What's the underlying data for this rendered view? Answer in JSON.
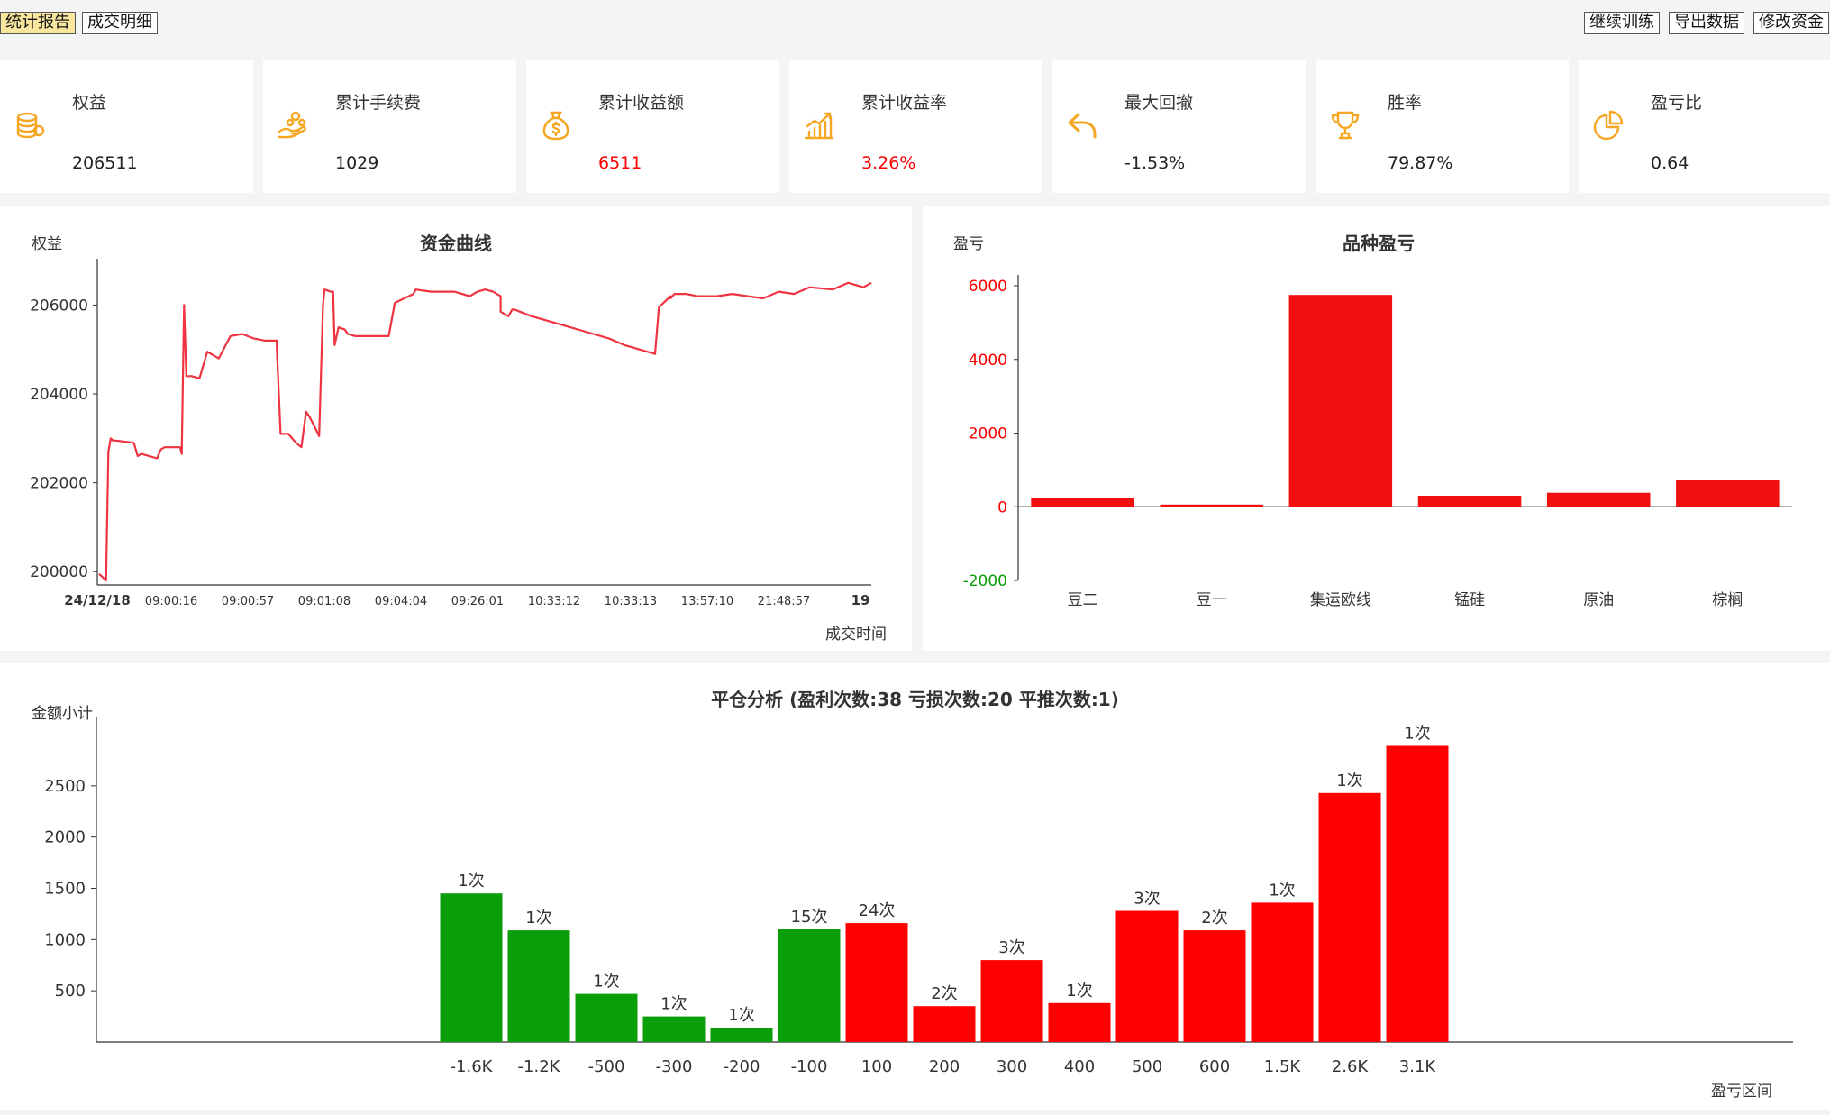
{
  "toolbar": {
    "tabs": [
      {
        "label": "统计报告",
        "active": true
      },
      {
        "label": "成交明细",
        "active": false
      }
    ],
    "actions": [
      {
        "label": "继续训练"
      },
      {
        "label": "导出数据"
      },
      {
        "label": "修改资金"
      }
    ]
  },
  "colors": {
    "accent": "#f5a623",
    "profit": "#ff0000",
    "loss": "#0a9e0a",
    "line": "#ef3340",
    "highlight_tab": "#f9e79f"
  },
  "stats": [
    {
      "label": "权益",
      "value": "206511",
      "icon": "coin-stack-icon",
      "color": "#222222"
    },
    {
      "label": "累计手续费",
      "value": "1029",
      "icon": "hand-coins-icon",
      "color": "#222222"
    },
    {
      "label": "累计收益额",
      "value": "6511",
      "icon": "money-bag-icon",
      "color": "#ff0000"
    },
    {
      "label": "累计收益率",
      "value": "3.26%",
      "icon": "growth-chart-icon",
      "color": "#ff0000"
    },
    {
      "label": "最大回撤",
      "value": "-1.53%",
      "icon": "undo-arrow-icon",
      "color": "#222222"
    },
    {
      "label": "胜率",
      "value": "79.87%",
      "icon": "trophy-icon",
      "color": "#222222"
    },
    {
      "label": "盈亏比",
      "value": "0.64",
      "icon": "pie-chart-icon",
      "color": "#222222"
    }
  ],
  "chart_data": [
    {
      "type": "line",
      "title": "资金曲线",
      "ylabel": "权益",
      "xlabel": "成交时间",
      "ylim": [
        199700,
        206800
      ],
      "yticks": [
        200000,
        202000,
        204000,
        206000
      ],
      "xticks": [
        "24/12/18",
        "09:00:16",
        "09:00:57",
        "09:01:08",
        "09:04:04",
        "09:26:01",
        "10:33:12",
        "10:33:13",
        "13:57:10",
        "21:48:57",
        "19"
      ],
      "x": [
        0.0,
        0.009,
        0.012,
        0.015,
        0.018,
        0.022,
        0.045,
        0.05,
        0.055,
        0.075,
        0.08,
        0.085,
        0.095,
        0.105,
        0.107,
        0.11,
        0.113,
        0.12,
        0.13,
        0.14,
        0.145,
        0.155,
        0.17,
        0.185,
        0.2,
        0.215,
        0.23,
        0.23,
        0.235,
        0.245,
        0.255,
        0.262,
        0.268,
        0.272,
        0.278,
        0.285,
        0.29,
        0.292,
        0.3,
        0.303,
        0.305,
        0.31,
        0.318,
        0.322,
        0.332,
        0.355,
        0.375,
        0.383,
        0.407,
        0.41,
        0.43,
        0.445,
        0.46,
        0.48,
        0.49,
        0.5,
        0.51,
        0.52,
        0.52,
        0.53,
        0.535,
        0.538,
        0.545,
        0.56,
        0.58,
        0.6,
        0.62,
        0.64,
        0.66,
        0.68,
        0.7,
        0.72,
        0.725,
        0.728,
        0.74,
        0.74,
        0.745,
        0.76,
        0.775,
        0.8,
        0.82,
        0.84,
        0.86,
        0.88,
        0.9,
        0.92,
        0.95,
        0.97,
        0.99,
        1.0
      ],
      "y": [
        199950,
        199800,
        202700,
        203000,
        202950,
        202950,
        202900,
        202600,
        202650,
        202550,
        202750,
        202800,
        202800,
        202800,
        202650,
        206000,
        204400,
        204400,
        204350,
        204950,
        204900,
        204800,
        205300,
        205350,
        205250,
        205200,
        205200,
        205100,
        203100,
        203100,
        202900,
        202800,
        203600,
        203500,
        203300,
        203050,
        206000,
        206350,
        206300,
        206300,
        205100,
        205500,
        205450,
        205350,
        205300,
        205300,
        205300,
        206050,
        206250,
        206350,
        206300,
        206300,
        206300,
        206200,
        206300,
        206350,
        206300,
        206200,
        205850,
        205750,
        205900,
        205900,
        205850,
        205750,
        205650,
        205550,
        205450,
        205350,
        205250,
        205100,
        205000,
        204900,
        205950,
        206000,
        206200,
        206150,
        206250,
        206250,
        206200,
        206200,
        206250,
        206200,
        206150,
        206300,
        206250,
        206400,
        206350,
        206500,
        206400,
        206500
      ]
    },
    {
      "type": "bar",
      "title": "品种盈亏",
      "ylabel": "盈亏",
      "categories": [
        "豆二",
        "豆一",
        "集运欧线",
        "锰硅",
        "原油",
        "棕榈"
      ],
      "values": [
        230,
        60,
        5750,
        300,
        380,
        730
      ],
      "ylim": [
        -2000,
        6000
      ],
      "yticks": [
        -2000,
        0,
        2000,
        4000,
        6000
      ]
    },
    {
      "type": "bar",
      "title": "平仓分析 (盈利次数:38 亏损次数:20 平推次数:1)",
      "ylabel": "金额小计",
      "xlabel": "盈亏区间",
      "categories": [
        "-1.6K",
        "-1.2K",
        "-500",
        "-300",
        "-200",
        "-100",
        "100",
        "200",
        "300",
        "400",
        "500",
        "600",
        "1.5K",
        "2.6K",
        "3.1K"
      ],
      "values": [
        1450,
        1090,
        470,
        250,
        140,
        1100,
        1160,
        350,
        800,
        380,
        1280,
        1090,
        1360,
        2430,
        2890
      ],
      "counts": [
        "1次",
        "1次",
        "1次",
        "1次",
        "1次",
        "15次",
        "24次",
        "2次",
        "3次",
        "1次",
        "3次",
        "2次",
        "1次",
        "1次",
        "1次"
      ],
      "ylim": [
        0,
        3000
      ],
      "yticks": [
        500,
        1000,
        1500,
        2000,
        2500
      ]
    }
  ]
}
